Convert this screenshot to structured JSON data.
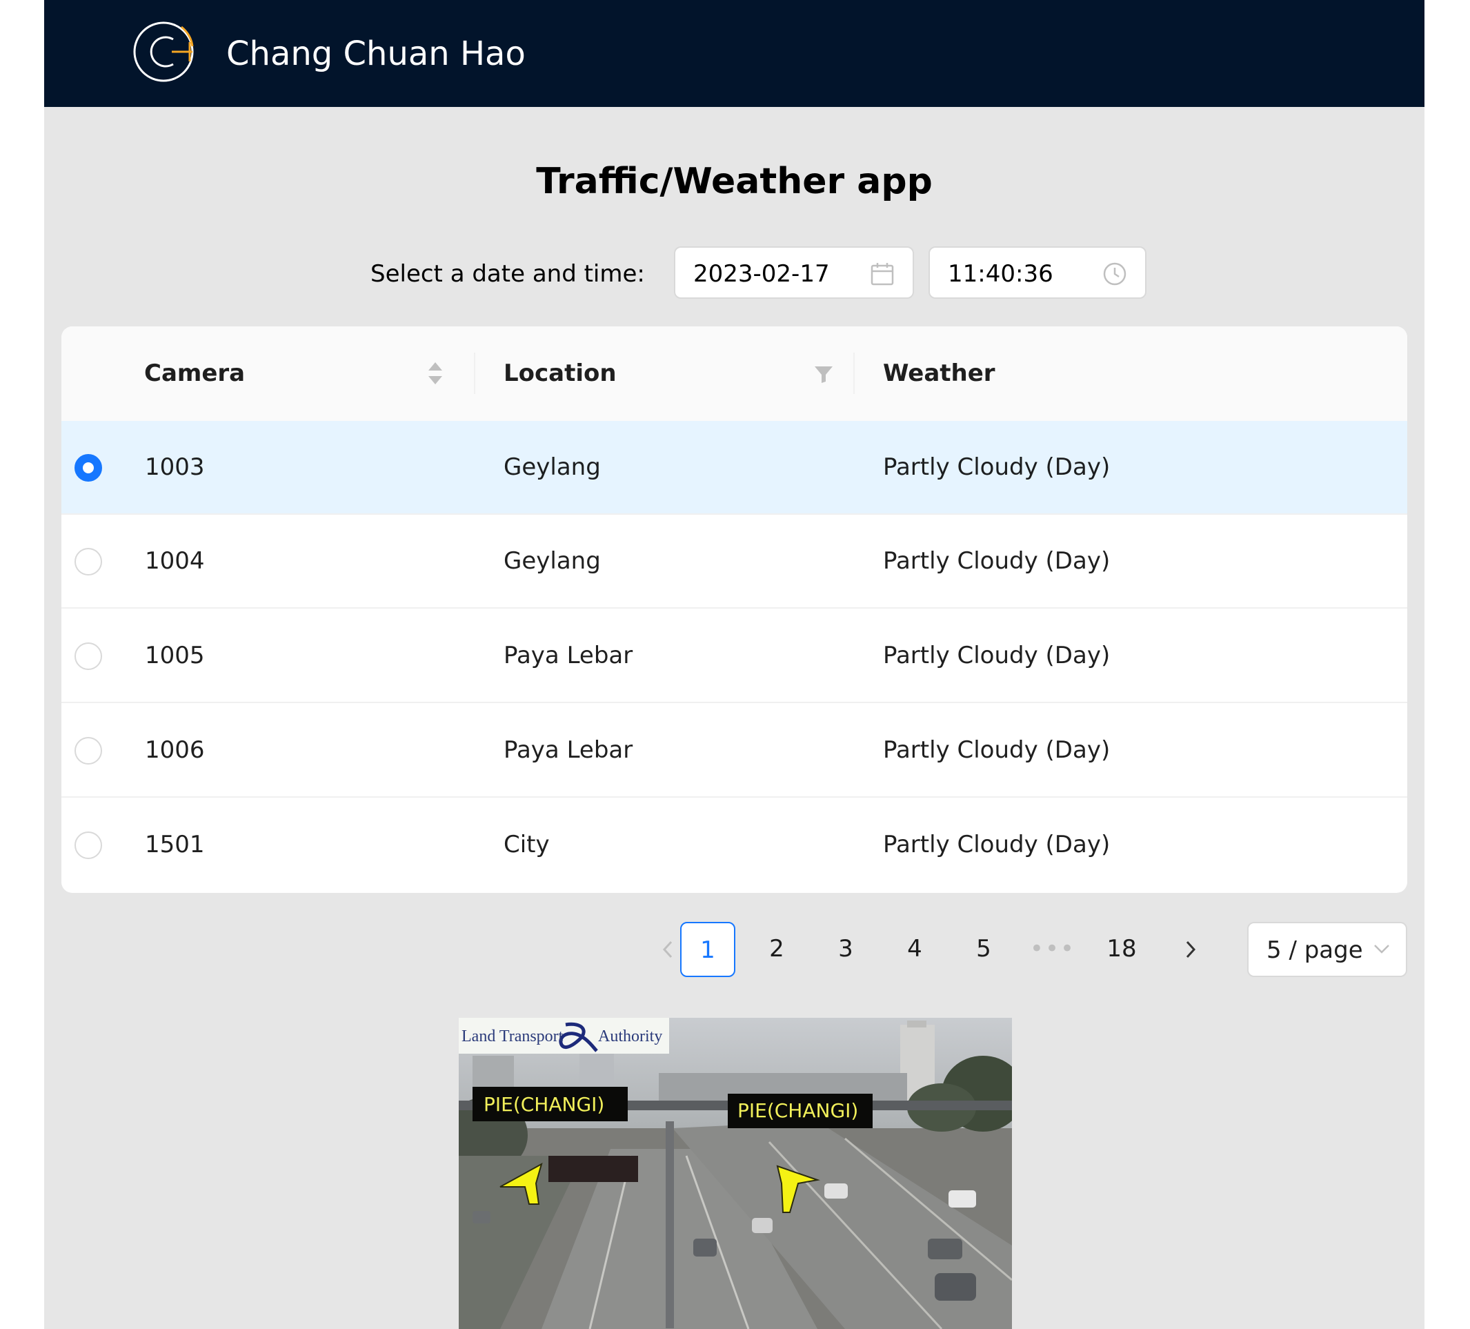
{
  "header": {
    "brand": "Chang Chuan Hao",
    "logo_icon": "ch-logo-icon"
  },
  "title": "Traffic/Weather app",
  "picker": {
    "label": "Select a date and time:",
    "date_value": "2023-02-17",
    "time_value": "11:40:36"
  },
  "table": {
    "columns": {
      "camera": "Camera",
      "location": "Location",
      "weather": "Weather"
    },
    "rows": [
      {
        "camera": "1003",
        "location": "Geylang",
        "weather": "Partly Cloudy (Day)",
        "selected": true
      },
      {
        "camera": "1004",
        "location": "Geylang",
        "weather": "Partly Cloudy (Day)",
        "selected": false
      },
      {
        "camera": "1005",
        "location": "Paya Lebar",
        "weather": "Partly Cloudy (Day)",
        "selected": false
      },
      {
        "camera": "1006",
        "location": "Paya Lebar",
        "weather": "Partly Cloudy (Day)",
        "selected": false
      },
      {
        "camera": "1501",
        "location": "City",
        "weather": "Partly Cloudy (Day)",
        "selected": false
      }
    ]
  },
  "pagination": {
    "pages": [
      "1",
      "2",
      "3",
      "4",
      "5",
      "•••",
      "18"
    ],
    "current": "1",
    "page_size": "5 / page"
  },
  "camera_image": {
    "watermark_left": "Land Transport",
    "watermark_right": "Authority",
    "sign_left": "PIE(CHANGI)",
    "sign_right": "PIE(CHANGI)"
  },
  "colors": {
    "header_bg": "#02142b",
    "accent": "#1677ff",
    "page_bg": "#e6e6e6",
    "logo_orange": "#f5a623"
  }
}
